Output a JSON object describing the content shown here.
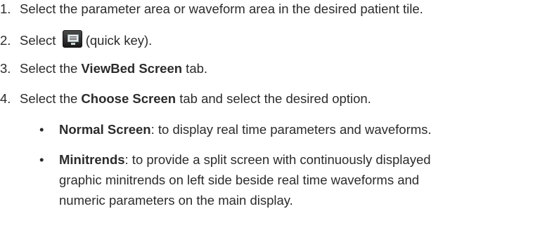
{
  "steps": [
    {
      "num": "1.",
      "text": "Select the parameter area or waveform area in the desired patient tile."
    },
    {
      "num": "2.",
      "before": "Select ",
      "after": " (quick key).",
      "icon": "monitor-screen-icon"
    },
    {
      "num": "3.",
      "before": "Select the ",
      "bold": "ViewBed Screen",
      "after": " tab."
    },
    {
      "num": "4.",
      "before": "Select the ",
      "bold": "Choose Screen",
      "after": " tab and select the desired option."
    }
  ],
  "options": [
    {
      "bullet": "•",
      "term": "Normal Screen",
      "desc": ": to display real time parameters and waveforms."
    },
    {
      "bullet": "•",
      "term": "Minitrends",
      "desc": ": to provide a split screen with continuously displayed",
      "cont1": "graphic minitrends on left side beside real time waveforms and",
      "cont2": "numeric parameters on the main display."
    }
  ]
}
